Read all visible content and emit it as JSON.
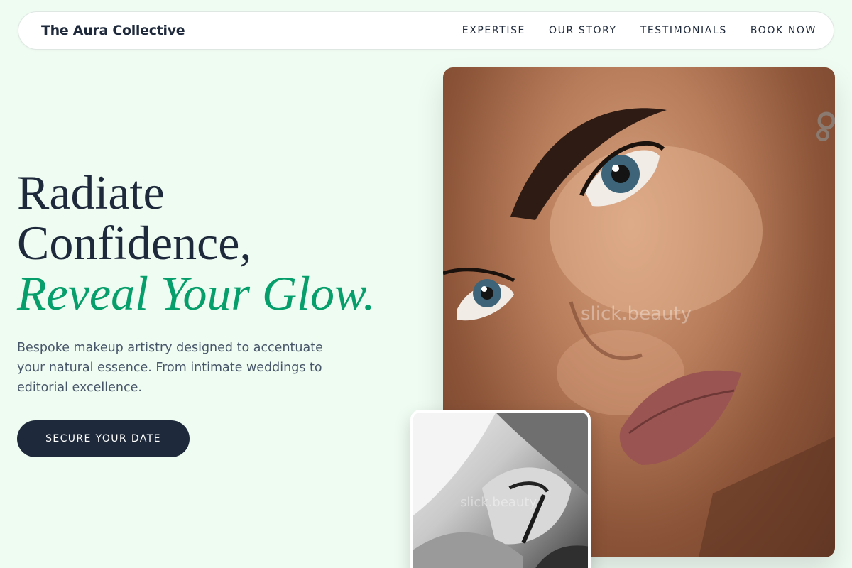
{
  "nav": {
    "brand": "The Aura Collective",
    "links": [
      "EXPERTISE",
      "OUR STORY",
      "TESTIMONIALS",
      "BOOK NOW"
    ]
  },
  "hero": {
    "headline_line1": "Radiate",
    "headline_line2": "Confidence,",
    "headline_accent": "Reveal Your Glow.",
    "lede": "Bespoke makeup artistry designed to accentuate your natural essence. From intimate weddings to editorial excellence.",
    "cta_label": "SECURE YOUR DATE"
  },
  "images": {
    "hero_watermark": "slick.beauty",
    "inset_watermark": "slick.beauty"
  },
  "colors": {
    "background": "#effcf2",
    "text": "#1e293b",
    "accent": "#069e6a",
    "button": "#1e293b"
  }
}
